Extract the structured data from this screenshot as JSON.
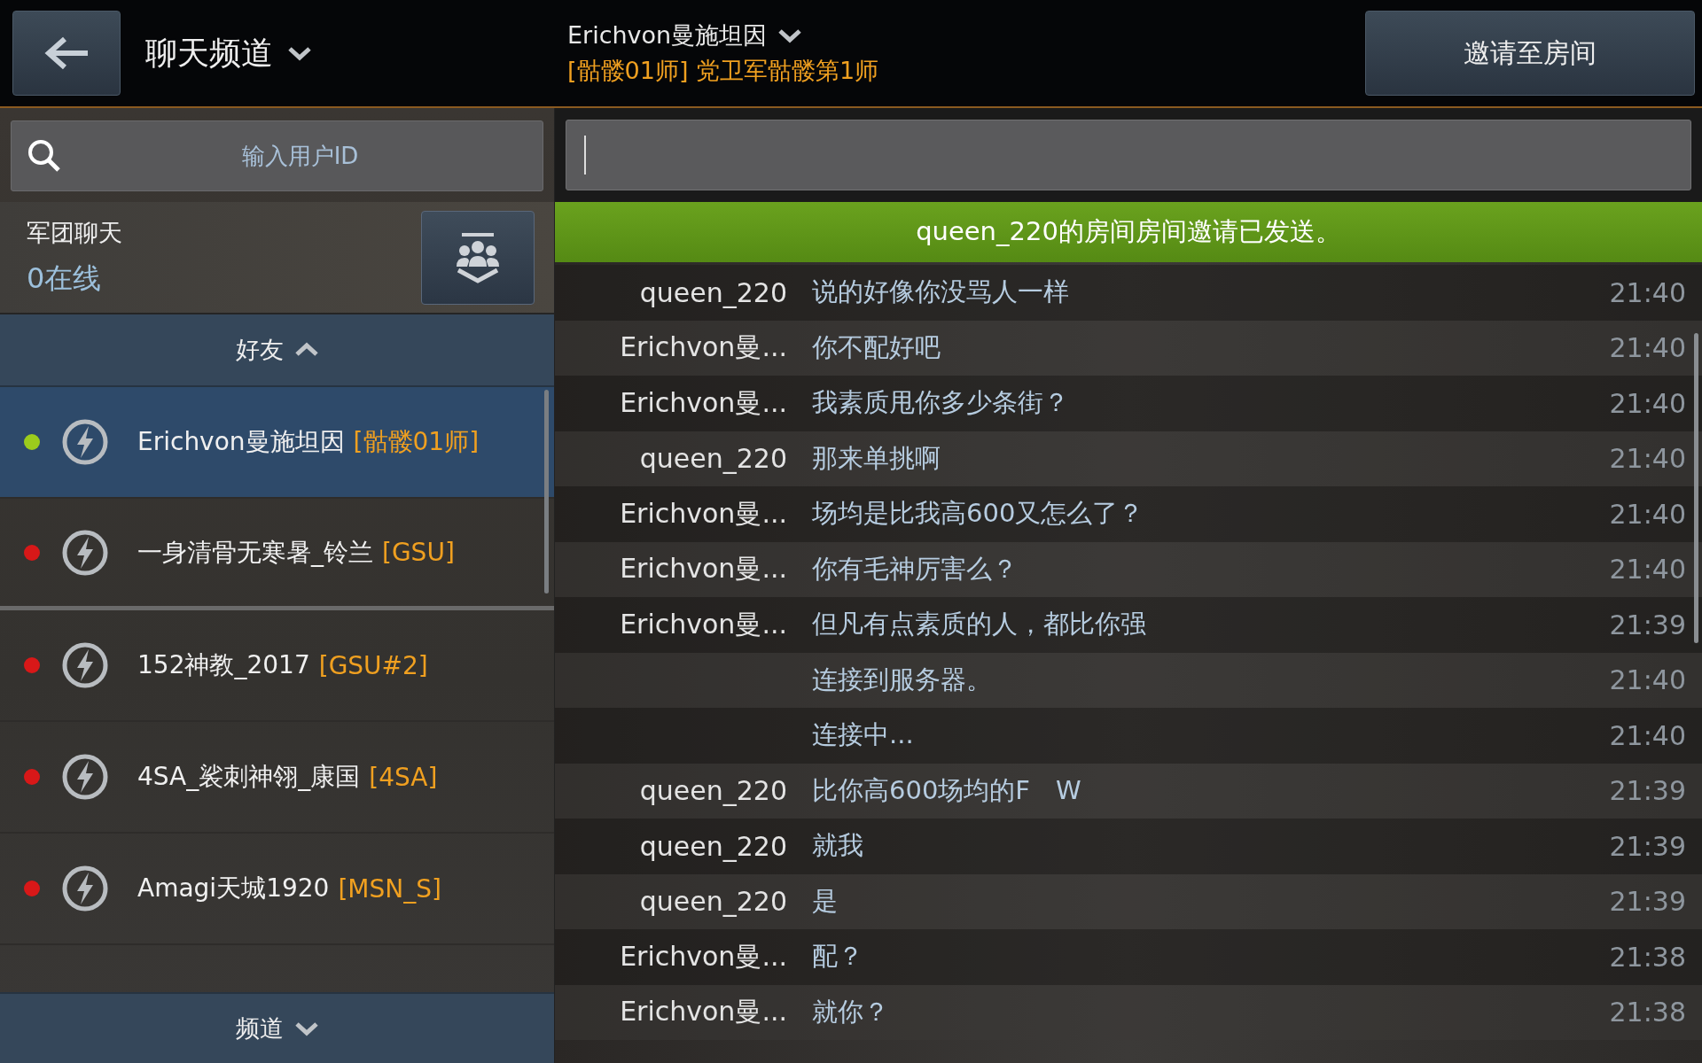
{
  "header": {
    "title": "聊天频道",
    "channel_name": "Erichvon曼施坦因",
    "channel_subtitle": "[骷髅01师] 党卫军骷髅第1师",
    "invite_button": "邀请至房间"
  },
  "search": {
    "placeholder": "输入用户ID"
  },
  "clan_chat": {
    "title": "军团聊天",
    "online": "0在线"
  },
  "friends_header": {
    "label": "好友",
    "expanded": true
  },
  "friends": [
    {
      "name": "Erichvon曼施坦因",
      "tag": "[骷髅01师]",
      "color": "#9ccc1c",
      "selected": true
    },
    {
      "name": "一身清骨无寒暑_铃兰",
      "tag": "[GSU]",
      "color": "#d81818",
      "selected": false
    },
    {
      "name": "152神教_2017",
      "tag": "[GSU#2]",
      "color": "#d81818",
      "selected": false
    },
    {
      "name": "4SA_裟刺神翎_康国",
      "tag": "[4SA]",
      "color": "#d81818",
      "selected": false
    },
    {
      "name": "Amagi天城1920",
      "tag": "[MSN_S]",
      "color": "#d81818",
      "selected": false
    }
  ],
  "channels_footer": {
    "label": "频道",
    "expanded": false
  },
  "notice": "queen_220的房间房间邀请已发送。",
  "messages": [
    {
      "kind": "user",
      "sender": "queen_220",
      "text": "说的好像你没骂人一样",
      "time": "21:40"
    },
    {
      "kind": "user",
      "sender": "Erichvon曼...",
      "text": "你不配好吧",
      "time": "21:40"
    },
    {
      "kind": "user",
      "sender": "Erichvon曼...",
      "text": "我素质甩你多少条街？",
      "time": "21:40"
    },
    {
      "kind": "user",
      "sender": "queen_220",
      "text": "那来单挑啊",
      "time": "21:40"
    },
    {
      "kind": "user",
      "sender": "Erichvon曼...",
      "text": "场均是比我高600又怎么了？",
      "time": "21:40"
    },
    {
      "kind": "user",
      "sender": "Erichvon曼...",
      "text": "你有毛神厉害么？",
      "time": "21:40"
    },
    {
      "kind": "user",
      "sender": "Erichvon曼...",
      "text": "但凡有点素质的人，都比你强",
      "time": "21:39"
    },
    {
      "kind": "system",
      "text": "连接到服务器。",
      "time": "21:40"
    },
    {
      "kind": "system",
      "text": "连接中...",
      "time": "21:40"
    },
    {
      "kind": "user",
      "sender": "queen_220",
      "text": "比你高600场均的F　W",
      "time": "21:39"
    },
    {
      "kind": "user",
      "sender": "queen_220",
      "text": "就我",
      "time": "21:39"
    },
    {
      "kind": "user",
      "sender": "queen_220",
      "text": "是",
      "time": "21:39"
    },
    {
      "kind": "user",
      "sender": "Erichvon曼...",
      "text": "配？",
      "time": "21:38"
    },
    {
      "kind": "user",
      "sender": "Erichvon曼...",
      "text": "就你？",
      "time": "21:38"
    }
  ]
}
